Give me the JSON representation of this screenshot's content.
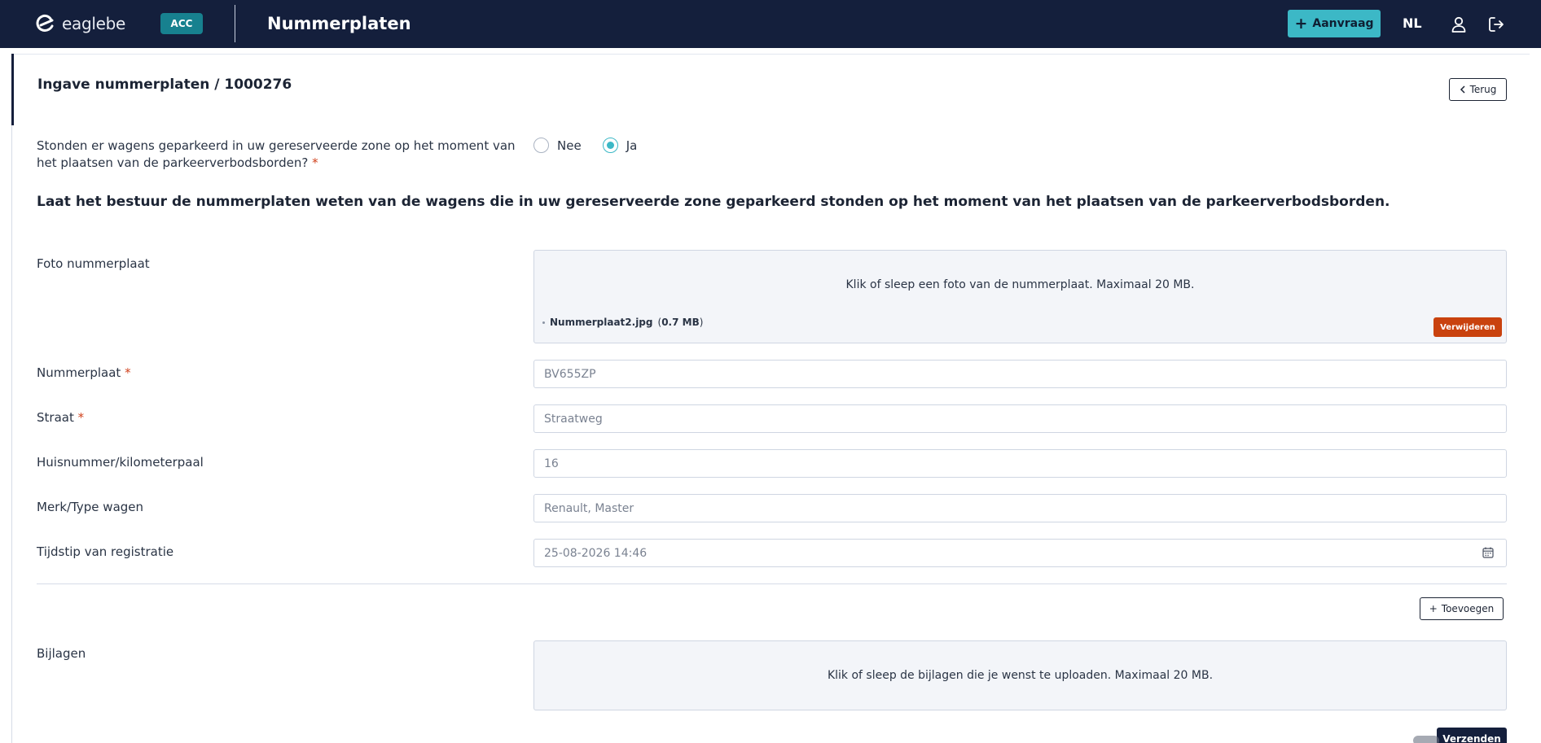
{
  "header": {
    "logo_text": "eaglebe",
    "env_badge": "ACC",
    "app_title": "Nummerplaten",
    "new_request_label": "Aanvraag",
    "language": "NL",
    "icons": [
      "user-icon",
      "logout-icon"
    ]
  },
  "page": {
    "title": "Ingave nummerplaten / 1000276",
    "back_label": "Terug"
  },
  "question": {
    "text": "Stonden er wagens geparkeerd in uw gereserveerde zone op het moment van het plaatsen van de parkeerverbodsborden?",
    "required_mark": "*",
    "options": [
      {
        "label": "Nee",
        "selected": false
      },
      {
        "label": "Ja",
        "selected": true
      }
    ]
  },
  "instruction": "Laat het bestuur de nummerplaten weten van de wagens die in uw gereserveerde zone geparkeerd stonden op het moment van het plaatsen van de parkeerverbodsborden.",
  "form": {
    "photo": {
      "label": "Foto nummerplaat",
      "dropzone_text": "Klik of sleep een foto van de nummerplaat. Maximaal 20 MB.",
      "file_name": "Nummerplaat2.jpg",
      "file_size": "0.7 MB",
      "remove_label": "Verwijderen"
    },
    "plate": {
      "label": "Nummerplaat",
      "required_mark": "*",
      "value": "BV655ZP"
    },
    "street": {
      "label": "Straat",
      "required_mark": "*",
      "value": "Straatweg"
    },
    "house_number": {
      "label": "Huisnummer/kilometerpaal",
      "value": "16"
    },
    "make_model": {
      "label": "Merk/Type wagen",
      "value": "Renault, Master"
    },
    "registered_at": {
      "label": "Tijdstip van registratie",
      "value": "25-08-2026 14:46"
    }
  },
  "add_label": "Toevoegen",
  "attachments": {
    "label": "Bijlagen",
    "dropzone_text": "Klik of sleep de bijlagen die je wenst te uploaden. Maximaal 20 MB."
  },
  "submit_label": "Verzenden",
  "colors": {
    "navbar": "#141f3c",
    "accent": "#3cb8c6",
    "env_badge": "#17818f",
    "danger": "#c9420e",
    "required": "#d0411c"
  }
}
